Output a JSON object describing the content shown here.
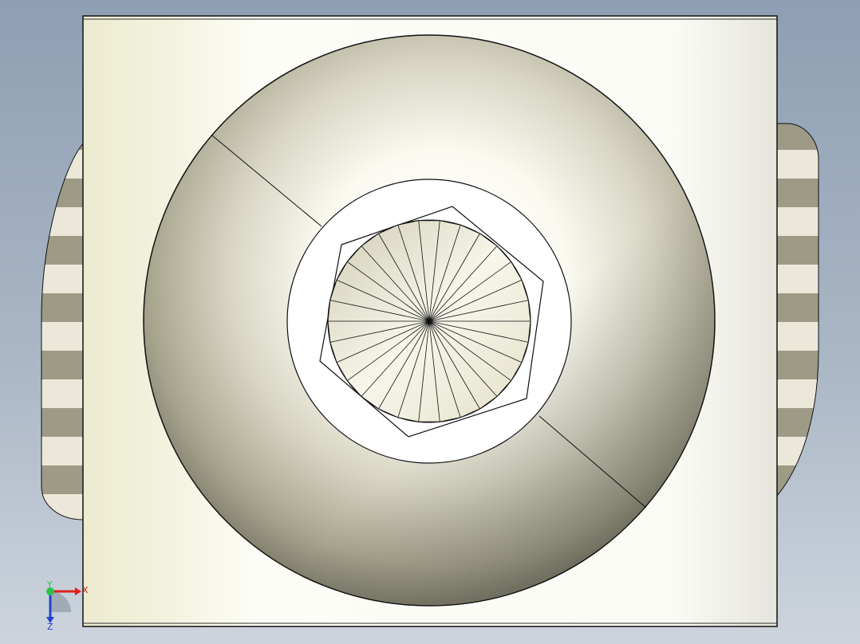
{
  "viewport": {
    "model": "part-top-view",
    "colors": {
      "background_top": "#8e9fb3",
      "background_bottom": "#cdd4dd",
      "body_light": "#fbfbf4",
      "body_shade": "#e6e6cc",
      "stripe_dark": "#9d9a86",
      "stripe_light": "#ece8d9",
      "edge": "#111111"
    }
  },
  "triad": {
    "x_label": "X",
    "y_label": "Y",
    "z_label": "Z",
    "x_color": "#e0201a",
    "y_color": "#2cc24a",
    "z_color": "#2244cc"
  }
}
